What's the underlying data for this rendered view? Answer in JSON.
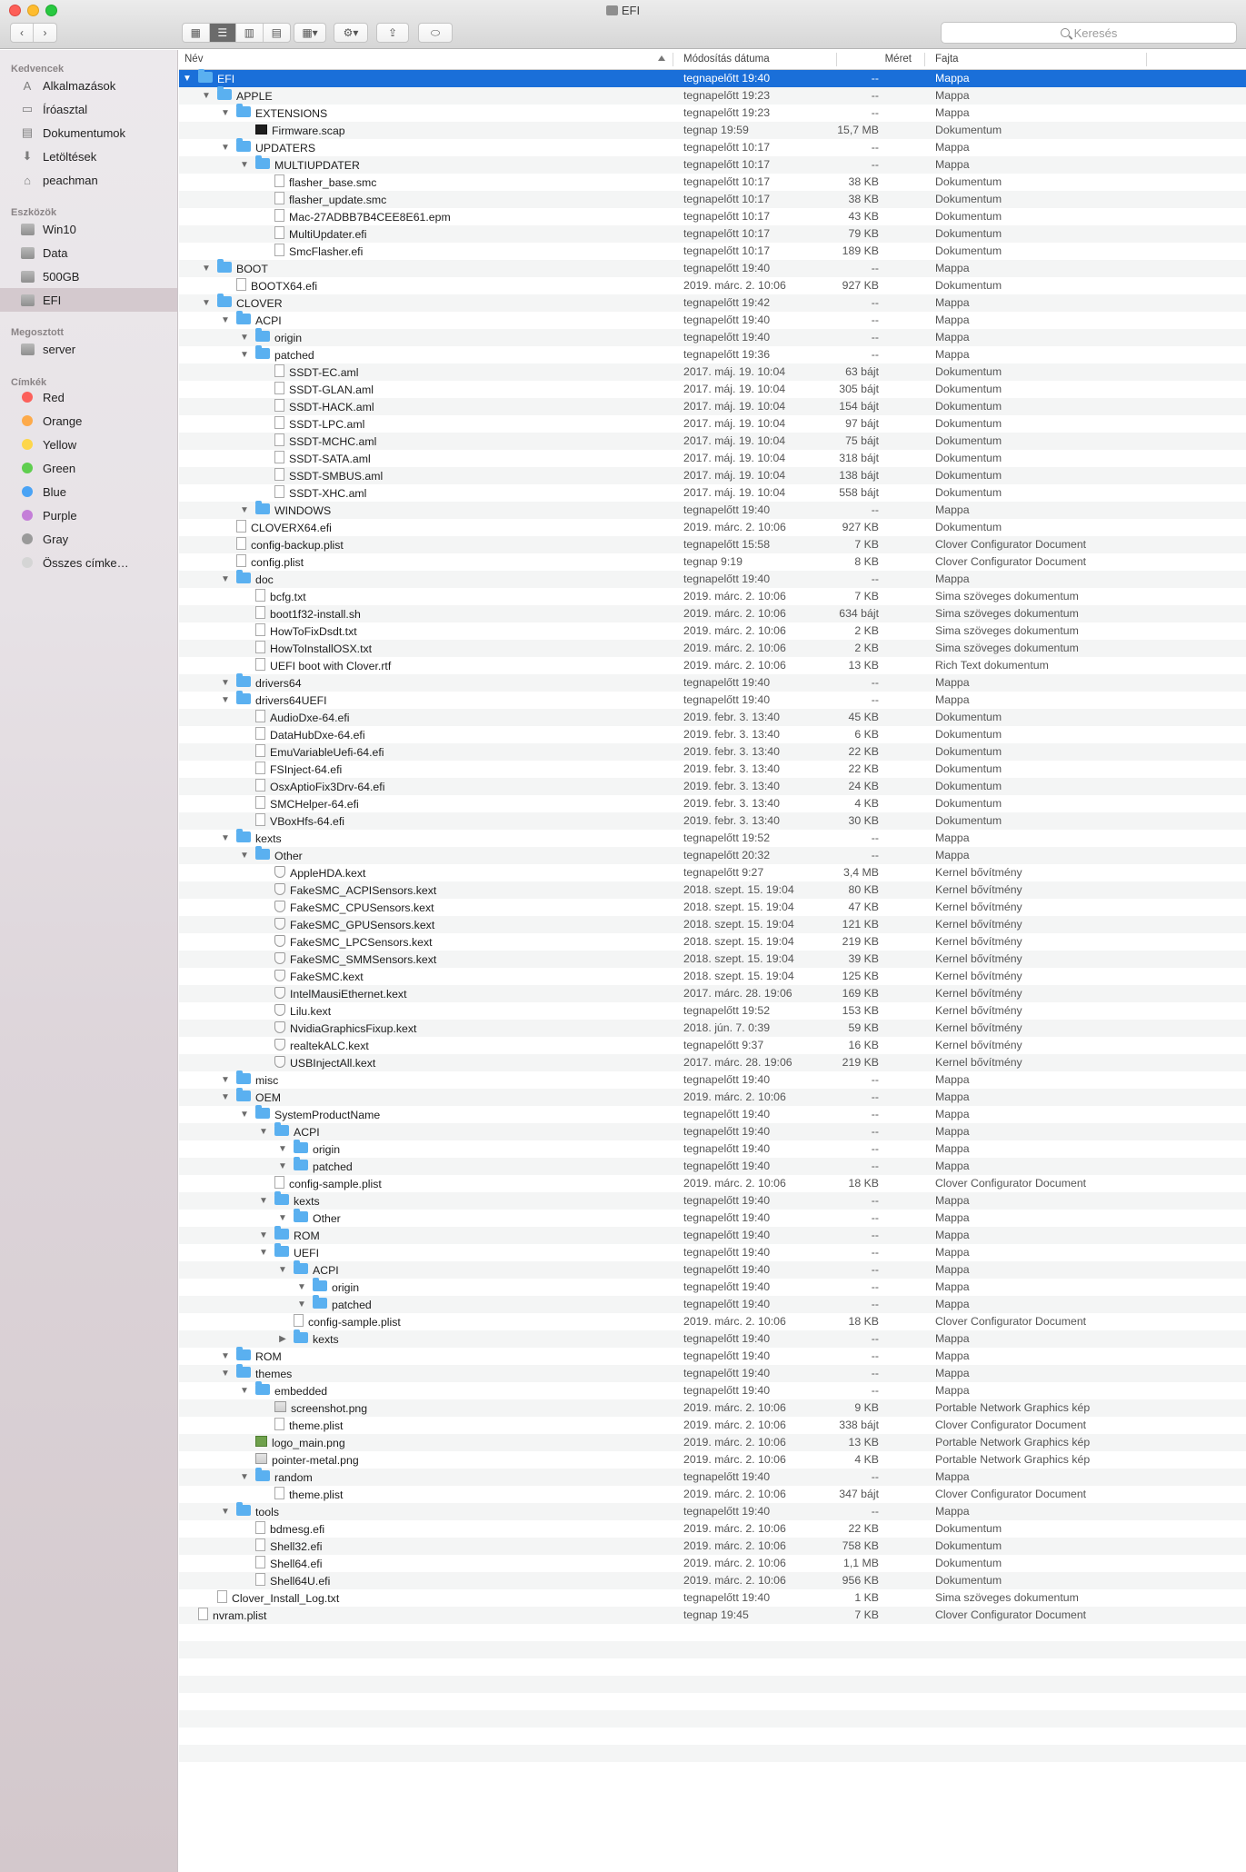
{
  "window": {
    "title": "EFI"
  },
  "toolbar": {
    "search_placeholder": "Keresés"
  },
  "sidebar": {
    "sections": [
      {
        "title": "Kedvencek",
        "items": [
          {
            "label": "Alkalmazások",
            "icon": "apps-icon"
          },
          {
            "label": "Íróasztal",
            "icon": "desktop-icon"
          },
          {
            "label": "Dokumentumok",
            "icon": "documents-icon"
          },
          {
            "label": "Letöltések",
            "icon": "downloads-icon"
          },
          {
            "label": "peachman",
            "icon": "home-icon"
          }
        ]
      },
      {
        "title": "Eszközök",
        "items": [
          {
            "label": "Win10",
            "icon": "disk-icon"
          },
          {
            "label": "Data",
            "icon": "disk-icon"
          },
          {
            "label": "500GB",
            "icon": "disk-icon"
          },
          {
            "label": "EFI",
            "icon": "disk-icon",
            "selected": true
          }
        ]
      },
      {
        "title": "Megosztott",
        "items": [
          {
            "label": "server",
            "icon": "server-icon"
          }
        ]
      },
      {
        "title": "Címkék",
        "items": [
          {
            "label": "Red",
            "color": "#fc605b"
          },
          {
            "label": "Orange",
            "color": "#fdaa4a"
          },
          {
            "label": "Yellow",
            "color": "#fdd64a"
          },
          {
            "label": "Green",
            "color": "#5fce4f"
          },
          {
            "label": "Blue",
            "color": "#4aa3f5"
          },
          {
            "label": "Purple",
            "color": "#c47ed8"
          },
          {
            "label": "Gray",
            "color": "#9a9a9a"
          },
          {
            "label": "Összes címke…",
            "color": "#d5d5d5"
          }
        ]
      }
    ]
  },
  "columns": {
    "name": "Név",
    "date": "Módosítás dátuma",
    "size": "Méret",
    "kind": "Fajta"
  },
  "rows": [
    {
      "n": "EFI",
      "d": "tegnapelőtt 19:40",
      "s": "--",
      "k": "Mappa",
      "l": 0,
      "t": "f",
      "x": "o"
    },
    {
      "n": "APPLE",
      "d": "tegnapelőtt 19:23",
      "s": "--",
      "k": "Mappa",
      "l": 1,
      "t": "f",
      "x": "o"
    },
    {
      "n": "EXTENSIONS",
      "d": "tegnapelőtt 19:23",
      "s": "--",
      "k": "Mappa",
      "l": 2,
      "t": "f",
      "x": "o"
    },
    {
      "n": "Firmware.scap",
      "d": "tegnap 19:59",
      "s": "15,7 MB",
      "k": "Dokumentum",
      "l": 3,
      "t": "dd",
      "x": ""
    },
    {
      "n": "UPDATERS",
      "d": "tegnapelőtt 10:17",
      "s": "--",
      "k": "Mappa",
      "l": 2,
      "t": "f",
      "x": "o"
    },
    {
      "n": "MULTIUPDATER",
      "d": "tegnapelőtt 10:17",
      "s": "--",
      "k": "Mappa",
      "l": 3,
      "t": "f",
      "x": "o"
    },
    {
      "n": "flasher_base.smc",
      "d": "tegnapelőtt 10:17",
      "s": "38 KB",
      "k": "Dokumentum",
      "l": 4,
      "t": "d",
      "x": ""
    },
    {
      "n": "flasher_update.smc",
      "d": "tegnapelőtt 10:17",
      "s": "38 KB",
      "k": "Dokumentum",
      "l": 4,
      "t": "d",
      "x": ""
    },
    {
      "n": "Mac-27ADBB7B4CEE8E61.epm",
      "d": "tegnapelőtt 10:17",
      "s": "43 KB",
      "k": "Dokumentum",
      "l": 4,
      "t": "d",
      "x": ""
    },
    {
      "n": "MultiUpdater.efi",
      "d": "tegnapelőtt 10:17",
      "s": "79 KB",
      "k": "Dokumentum",
      "l": 4,
      "t": "d",
      "x": ""
    },
    {
      "n": "SmcFlasher.efi",
      "d": "tegnapelőtt 10:17",
      "s": "189 KB",
      "k": "Dokumentum",
      "l": 4,
      "t": "d",
      "x": ""
    },
    {
      "n": "BOOT",
      "d": "tegnapelőtt 19:40",
      "s": "--",
      "k": "Mappa",
      "l": 1,
      "t": "f",
      "x": "o"
    },
    {
      "n": "BOOTX64.efi",
      "d": "2019. márc. 2. 10:06",
      "s": "927 KB",
      "k": "Dokumentum",
      "l": 2,
      "t": "d",
      "x": ""
    },
    {
      "n": "CLOVER",
      "d": "tegnapelőtt 19:42",
      "s": "--",
      "k": "Mappa",
      "l": 1,
      "t": "f",
      "x": "o"
    },
    {
      "n": "ACPI",
      "d": "tegnapelőtt 19:40",
      "s": "--",
      "k": "Mappa",
      "l": 2,
      "t": "f",
      "x": "o"
    },
    {
      "n": "origin",
      "d": "tegnapelőtt 19:40",
      "s": "--",
      "k": "Mappa",
      "l": 3,
      "t": "f",
      "x": "o"
    },
    {
      "n": "patched",
      "d": "tegnapelőtt 19:36",
      "s": "--",
      "k": "Mappa",
      "l": 3,
      "t": "f",
      "x": "o"
    },
    {
      "n": "SSDT-EC.aml",
      "d": "2017. máj. 19. 10:04",
      "s": "63 bájt",
      "k": "Dokumentum",
      "l": 4,
      "t": "d",
      "x": ""
    },
    {
      "n": "SSDT-GLAN.aml",
      "d": "2017. máj. 19. 10:04",
      "s": "305 bájt",
      "k": "Dokumentum",
      "l": 4,
      "t": "d",
      "x": ""
    },
    {
      "n": "SSDT-HACK.aml",
      "d": "2017. máj. 19. 10:04",
      "s": "154 bájt",
      "k": "Dokumentum",
      "l": 4,
      "t": "d",
      "x": ""
    },
    {
      "n": "SSDT-LPC.aml",
      "d": "2017. máj. 19. 10:04",
      "s": "97 bájt",
      "k": "Dokumentum",
      "l": 4,
      "t": "d",
      "x": ""
    },
    {
      "n": "SSDT-MCHC.aml",
      "d": "2017. máj. 19. 10:04",
      "s": "75 bájt",
      "k": "Dokumentum",
      "l": 4,
      "t": "d",
      "x": ""
    },
    {
      "n": "SSDT-SATA.aml",
      "d": "2017. máj. 19. 10:04",
      "s": "318 bájt",
      "k": "Dokumentum",
      "l": 4,
      "t": "d",
      "x": ""
    },
    {
      "n": "SSDT-SMBUS.aml",
      "d": "2017. máj. 19. 10:04",
      "s": "138 bájt",
      "k": "Dokumentum",
      "l": 4,
      "t": "d",
      "x": ""
    },
    {
      "n": "SSDT-XHC.aml",
      "d": "2017. máj. 19. 10:04",
      "s": "558 bájt",
      "k": "Dokumentum",
      "l": 4,
      "t": "d",
      "x": ""
    },
    {
      "n": "WINDOWS",
      "d": "tegnapelőtt 19:40",
      "s": "--",
      "k": "Mappa",
      "l": 3,
      "t": "f",
      "x": "o"
    },
    {
      "n": "CLOVERX64.efi",
      "d": "2019. márc. 2. 10:06",
      "s": "927 KB",
      "k": "Dokumentum",
      "l": 2,
      "t": "d",
      "x": ""
    },
    {
      "n": "config-backup.plist",
      "d": "tegnapelőtt 15:58",
      "s": "7 KB",
      "k": "Clover Configurator Document",
      "l": 2,
      "t": "d",
      "x": ""
    },
    {
      "n": "config.plist",
      "d": "tegnap 9:19",
      "s": "8 KB",
      "k": "Clover Configurator Document",
      "l": 2,
      "t": "d",
      "x": ""
    },
    {
      "n": "doc",
      "d": "tegnapelőtt 19:40",
      "s": "--",
      "k": "Mappa",
      "l": 2,
      "t": "f",
      "x": "o"
    },
    {
      "n": "bcfg.txt",
      "d": "2019. márc. 2. 10:06",
      "s": "7 KB",
      "k": "Sima szöveges dokumentum",
      "l": 3,
      "t": "d",
      "x": ""
    },
    {
      "n": "boot1f32-install.sh",
      "d": "2019. márc. 2. 10:06",
      "s": "634 bájt",
      "k": "Sima szöveges dokumentum",
      "l": 3,
      "t": "d",
      "x": ""
    },
    {
      "n": "HowToFixDsdt.txt",
      "d": "2019. márc. 2. 10:06",
      "s": "2 KB",
      "k": "Sima szöveges dokumentum",
      "l": 3,
      "t": "d",
      "x": ""
    },
    {
      "n": "HowToInstallOSX.txt",
      "d": "2019. márc. 2. 10:06",
      "s": "2 KB",
      "k": "Sima szöveges dokumentum",
      "l": 3,
      "t": "d",
      "x": ""
    },
    {
      "n": "UEFI boot with Clover.rtf",
      "d": "2019. márc. 2. 10:06",
      "s": "13 KB",
      "k": "Rich Text dokumentum",
      "l": 3,
      "t": "d",
      "x": ""
    },
    {
      "n": "drivers64",
      "d": "tegnapelőtt 19:40",
      "s": "--",
      "k": "Mappa",
      "l": 2,
      "t": "f",
      "x": "o"
    },
    {
      "n": "drivers64UEFI",
      "d": "tegnapelőtt 19:40",
      "s": "--",
      "k": "Mappa",
      "l": 2,
      "t": "f",
      "x": "o"
    },
    {
      "n": "AudioDxe-64.efi",
      "d": "2019. febr. 3. 13:40",
      "s": "45 KB",
      "k": "Dokumentum",
      "l": 3,
      "t": "d",
      "x": ""
    },
    {
      "n": "DataHubDxe-64.efi",
      "d": "2019. febr. 3. 13:40",
      "s": "6 KB",
      "k": "Dokumentum",
      "l": 3,
      "t": "d",
      "x": ""
    },
    {
      "n": "EmuVariableUefi-64.efi",
      "d": "2019. febr. 3. 13:40",
      "s": "22 KB",
      "k": "Dokumentum",
      "l": 3,
      "t": "d",
      "x": ""
    },
    {
      "n": "FSInject-64.efi",
      "d": "2019. febr. 3. 13:40",
      "s": "22 KB",
      "k": "Dokumentum",
      "l": 3,
      "t": "d",
      "x": ""
    },
    {
      "n": "OsxAptioFix3Drv-64.efi",
      "d": "2019. febr. 3. 13:40",
      "s": "24 KB",
      "k": "Dokumentum",
      "l": 3,
      "t": "d",
      "x": ""
    },
    {
      "n": "SMCHelper-64.efi",
      "d": "2019. febr. 3. 13:40",
      "s": "4 KB",
      "k": "Dokumentum",
      "l": 3,
      "t": "d",
      "x": ""
    },
    {
      "n": "VBoxHfs-64.efi",
      "d": "2019. febr. 3. 13:40",
      "s": "30 KB",
      "k": "Dokumentum",
      "l": 3,
      "t": "d",
      "x": ""
    },
    {
      "n": "kexts",
      "d": "tegnapelőtt 19:52",
      "s": "--",
      "k": "Mappa",
      "l": 2,
      "t": "f",
      "x": "o"
    },
    {
      "n": "Other",
      "d": "tegnapelőtt 20:32",
      "s": "--",
      "k": "Mappa",
      "l": 3,
      "t": "f",
      "x": "o"
    },
    {
      "n": "AppleHDA.kext",
      "d": "tegnapelőtt 9:27",
      "s": "3,4 MB",
      "k": "Kernel bővítmény",
      "l": 4,
      "t": "k",
      "x": ""
    },
    {
      "n": "FakeSMC_ACPISensors.kext",
      "d": "2018. szept. 15. 19:04",
      "s": "80 KB",
      "k": "Kernel bővítmény",
      "l": 4,
      "t": "k",
      "x": ""
    },
    {
      "n": "FakeSMC_CPUSensors.kext",
      "d": "2018. szept. 15. 19:04",
      "s": "47 KB",
      "k": "Kernel bővítmény",
      "l": 4,
      "t": "k",
      "x": ""
    },
    {
      "n": "FakeSMC_GPUSensors.kext",
      "d": "2018. szept. 15. 19:04",
      "s": "121 KB",
      "k": "Kernel bővítmény",
      "l": 4,
      "t": "k",
      "x": ""
    },
    {
      "n": "FakeSMC_LPCSensors.kext",
      "d": "2018. szept. 15. 19:04",
      "s": "219 KB",
      "k": "Kernel bővítmény",
      "l": 4,
      "t": "k",
      "x": ""
    },
    {
      "n": "FakeSMC_SMMSensors.kext",
      "d": "2018. szept. 15. 19:04",
      "s": "39 KB",
      "k": "Kernel bővítmény",
      "l": 4,
      "t": "k",
      "x": ""
    },
    {
      "n": "FakeSMC.kext",
      "d": "2018. szept. 15. 19:04",
      "s": "125 KB",
      "k": "Kernel bővítmény",
      "l": 4,
      "t": "k",
      "x": ""
    },
    {
      "n": "IntelMausiEthernet.kext",
      "d": "2017. márc. 28. 19:06",
      "s": "169 KB",
      "k": "Kernel bővítmény",
      "l": 4,
      "t": "k",
      "x": ""
    },
    {
      "n": "Lilu.kext",
      "d": "tegnapelőtt 19:52",
      "s": "153 KB",
      "k": "Kernel bővítmény",
      "l": 4,
      "t": "k",
      "x": ""
    },
    {
      "n": "NvidiaGraphicsFixup.kext",
      "d": "2018. jún. 7. 0:39",
      "s": "59 KB",
      "k": "Kernel bővítmény",
      "l": 4,
      "t": "k",
      "x": ""
    },
    {
      "n": "realtekALC.kext",
      "d": "tegnapelőtt 9:37",
      "s": "16 KB",
      "k": "Kernel bővítmény",
      "l": 4,
      "t": "k",
      "x": ""
    },
    {
      "n": "USBInjectAll.kext",
      "d": "2017. márc. 28. 19:06",
      "s": "219 KB",
      "k": "Kernel bővítmény",
      "l": 4,
      "t": "k",
      "x": ""
    },
    {
      "n": "misc",
      "d": "tegnapelőtt 19:40",
      "s": "--",
      "k": "Mappa",
      "l": 2,
      "t": "f",
      "x": "o"
    },
    {
      "n": "OEM",
      "d": "2019. márc. 2. 10:06",
      "s": "--",
      "k": "Mappa",
      "l": 2,
      "t": "f",
      "x": "o"
    },
    {
      "n": "SystemProductName",
      "d": "tegnapelőtt 19:40",
      "s": "--",
      "k": "Mappa",
      "l": 3,
      "t": "f",
      "x": "o"
    },
    {
      "n": "ACPI",
      "d": "tegnapelőtt 19:40",
      "s": "--",
      "k": "Mappa",
      "l": 4,
      "t": "f",
      "x": "o"
    },
    {
      "n": "origin",
      "d": "tegnapelőtt 19:40",
      "s": "--",
      "k": "Mappa",
      "l": 5,
      "t": "f",
      "x": "o"
    },
    {
      "n": "patched",
      "d": "tegnapelőtt 19:40",
      "s": "--",
      "k": "Mappa",
      "l": 5,
      "t": "f",
      "x": "o"
    },
    {
      "n": "config-sample.plist",
      "d": "2019. márc. 2. 10:06",
      "s": "18 KB",
      "k": "Clover Configurator Document",
      "l": 4,
      "t": "d",
      "x": ""
    },
    {
      "n": "kexts",
      "d": "tegnapelőtt 19:40",
      "s": "--",
      "k": "Mappa",
      "l": 4,
      "t": "f",
      "x": "o"
    },
    {
      "n": "Other",
      "d": "tegnapelőtt 19:40",
      "s": "--",
      "k": "Mappa",
      "l": 5,
      "t": "f",
      "x": "o"
    },
    {
      "n": "ROM",
      "d": "tegnapelőtt 19:40",
      "s": "--",
      "k": "Mappa",
      "l": 4,
      "t": "f",
      "x": "o"
    },
    {
      "n": "UEFI",
      "d": "tegnapelőtt 19:40",
      "s": "--",
      "k": "Mappa",
      "l": 4,
      "t": "f",
      "x": "o"
    },
    {
      "n": "ACPI",
      "d": "tegnapelőtt 19:40",
      "s": "--",
      "k": "Mappa",
      "l": 5,
      "t": "f",
      "x": "o"
    },
    {
      "n": "origin",
      "d": "tegnapelőtt 19:40",
      "s": "--",
      "k": "Mappa",
      "l": 6,
      "t": "f",
      "x": "o"
    },
    {
      "n": "patched",
      "d": "tegnapelőtt 19:40",
      "s": "--",
      "k": "Mappa",
      "l": 6,
      "t": "f",
      "x": "o"
    },
    {
      "n": "config-sample.plist",
      "d": "2019. márc. 2. 10:06",
      "s": "18 KB",
      "k": "Clover Configurator Document",
      "l": 5,
      "t": "d",
      "x": ""
    },
    {
      "n": "kexts",
      "d": "tegnapelőtt 19:40",
      "s": "--",
      "k": "Mappa",
      "l": 5,
      "t": "f",
      "x": "c"
    },
    {
      "n": "ROM",
      "d": "tegnapelőtt 19:40",
      "s": "--",
      "k": "Mappa",
      "l": 2,
      "t": "f",
      "x": "o"
    },
    {
      "n": "themes",
      "d": "tegnapelőtt 19:40",
      "s": "--",
      "k": "Mappa",
      "l": 2,
      "t": "f",
      "x": "o"
    },
    {
      "n": "embedded",
      "d": "tegnapelőtt 19:40",
      "s": "--",
      "k": "Mappa",
      "l": 3,
      "t": "f",
      "x": "o"
    },
    {
      "n": "screenshot.png",
      "d": "2019. márc. 2. 10:06",
      "s": "9 KB",
      "k": "Portable Network Graphics kép",
      "l": 4,
      "t": "i",
      "x": ""
    },
    {
      "n": "theme.plist",
      "d": "2019. márc. 2. 10:06",
      "s": "338 bájt",
      "k": "Clover Configurator Document",
      "l": 4,
      "t": "d",
      "x": ""
    },
    {
      "n": "logo_main.png",
      "d": "2019. márc. 2. 10:06",
      "s": "13 KB",
      "k": "Portable Network Graphics kép",
      "l": 3,
      "t": "ig",
      "x": ""
    },
    {
      "n": "pointer-metal.png",
      "d": "2019. márc. 2. 10:06",
      "s": "4 KB",
      "k": "Portable Network Graphics kép",
      "l": 3,
      "t": "i",
      "x": ""
    },
    {
      "n": "random",
      "d": "tegnapelőtt 19:40",
      "s": "--",
      "k": "Mappa",
      "l": 3,
      "t": "f",
      "x": "o"
    },
    {
      "n": "theme.plist",
      "d": "2019. márc. 2. 10:06",
      "s": "347 bájt",
      "k": "Clover Configurator Document",
      "l": 4,
      "t": "d",
      "x": ""
    },
    {
      "n": "tools",
      "d": "tegnapelőtt 19:40",
      "s": "--",
      "k": "Mappa",
      "l": 2,
      "t": "f",
      "x": "o"
    },
    {
      "n": "bdmesg.efi",
      "d": "2019. márc. 2. 10:06",
      "s": "22 KB",
      "k": "Dokumentum",
      "l": 3,
      "t": "d",
      "x": ""
    },
    {
      "n": "Shell32.efi",
      "d": "2019. márc. 2. 10:06",
      "s": "758 KB",
      "k": "Dokumentum",
      "l": 3,
      "t": "d",
      "x": ""
    },
    {
      "n": "Shell64.efi",
      "d": "2019. márc. 2. 10:06",
      "s": "1,1 MB",
      "k": "Dokumentum",
      "l": 3,
      "t": "d",
      "x": ""
    },
    {
      "n": "Shell64U.efi",
      "d": "2019. márc. 2. 10:06",
      "s": "956 KB",
      "k": "Dokumentum",
      "l": 3,
      "t": "d",
      "x": ""
    },
    {
      "n": "Clover_Install_Log.txt",
      "d": "tegnapelőtt 19:40",
      "s": "1 KB",
      "k": "Sima szöveges dokumentum",
      "l": 1,
      "t": "d",
      "x": ""
    },
    {
      "n": "nvram.plist",
      "d": "tegnap 19:45",
      "s": "7 KB",
      "k": "Clover Configurator Document",
      "l": 0,
      "t": "d",
      "x": ""
    }
  ]
}
